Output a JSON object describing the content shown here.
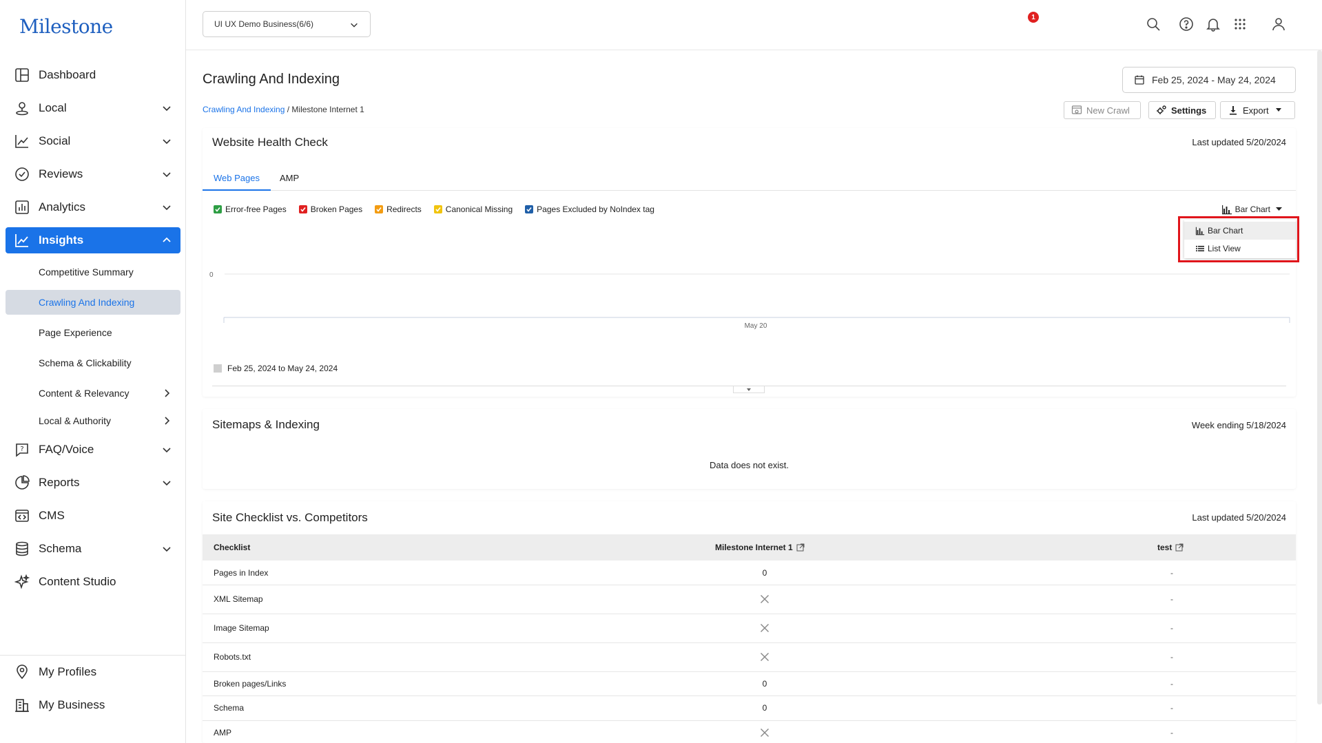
{
  "brand": "Milestone",
  "sidebar": {
    "nav": [
      {
        "id": "dashboard",
        "label": "Dashboard"
      },
      {
        "id": "local",
        "label": "Local"
      },
      {
        "id": "social",
        "label": "Social"
      },
      {
        "id": "reviews",
        "label": "Reviews"
      },
      {
        "id": "analytics",
        "label": "Analytics"
      },
      {
        "id": "insights",
        "label": "Insights"
      },
      {
        "id": "faq",
        "label": "FAQ/Voice"
      },
      {
        "id": "reports",
        "label": "Reports"
      },
      {
        "id": "cms",
        "label": "CMS"
      },
      {
        "id": "schema",
        "label": "Schema"
      },
      {
        "id": "content-studio",
        "label": "Content Studio"
      }
    ],
    "insights_sub": [
      "Competitive Summary",
      "Crawling And Indexing",
      "Page Experience",
      "Schema & Clickability",
      "Content & Relevancy",
      "Local & Authority"
    ],
    "bottom": [
      {
        "id": "profiles",
        "label": "My Profiles"
      },
      {
        "id": "business",
        "label": "My Business"
      }
    ]
  },
  "topbar": {
    "business_select": "UI UX Demo Business(6/6)",
    "notification_count": "1"
  },
  "page": {
    "title": "Crawling And Indexing",
    "date_range": "Feb 25, 2024 - May 24, 2024",
    "breadcrumb_link": "Crawling And Indexing",
    "breadcrumb_current": "/ Milestone Internet 1",
    "buttons": {
      "new_crawl": "New Crawl",
      "settings": "Settings",
      "export": "Export"
    }
  },
  "health_check": {
    "title": "Website Health Check",
    "updated": "Last updated 5/20/2024",
    "tabs": [
      "Web Pages",
      "AMP"
    ],
    "legend": [
      {
        "label": "Error-free Pages",
        "color": "#2e9e44"
      },
      {
        "label": "Broken Pages",
        "color": "#e02020"
      },
      {
        "label": "Redirects",
        "color": "#f39c12"
      },
      {
        "label": "Canonical Missing",
        "color": "#f1c40f"
      },
      {
        "label": "Pages Excluded by NoIndex tag",
        "color": "#1f5fa8"
      }
    ],
    "chart_type_label": "Bar Chart",
    "dropdown": [
      "Bar Chart",
      "List View"
    ],
    "y_tick": "0",
    "x_tick": "May 20",
    "period_label": "Feb 25, 2024 to May 24, 2024"
  },
  "chart_data": {
    "type": "bar",
    "categories": [
      "May 20"
    ],
    "series": [
      {
        "name": "Error-free Pages",
        "values": [
          0
        ]
      },
      {
        "name": "Broken Pages",
        "values": [
          0
        ]
      },
      {
        "name": "Redirects",
        "values": [
          0
        ]
      },
      {
        "name": "Canonical Missing",
        "values": [
          0
        ]
      },
      {
        "name": "Pages Excluded by NoIndex tag",
        "values": [
          0
        ]
      }
    ],
    "title": "",
    "xlabel": "",
    "ylabel": "",
    "legend": "top-left"
  },
  "sitemaps": {
    "title": "Sitemaps & Indexing",
    "week": "Week ending 5/18/2024",
    "empty": "Data does not exist."
  },
  "checklist": {
    "title": "Site Checklist vs. Competitors",
    "updated": "Last updated 5/20/2024",
    "headers": [
      "Checklist",
      "Milestone Internet 1",
      "test"
    ],
    "rows": [
      {
        "name": "Pages in Index",
        "a": "0",
        "b": "-"
      },
      {
        "name": "XML Sitemap",
        "a": "x",
        "b": "-"
      },
      {
        "name": "Image Sitemap",
        "a": "x",
        "b": "-"
      },
      {
        "name": "Robots.txt",
        "a": "x",
        "b": "-"
      },
      {
        "name": "Broken pages/Links",
        "a": "0",
        "b": "-"
      },
      {
        "name": "Schema",
        "a": "0",
        "b": "-"
      },
      {
        "name": "AMP",
        "a": "x",
        "b": "-"
      }
    ]
  }
}
